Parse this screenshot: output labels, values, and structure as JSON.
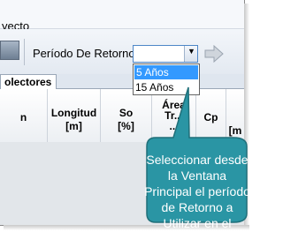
{
  "menu": {
    "item": "yecto"
  },
  "toolbar": {
    "label": "Período De Retorno:"
  },
  "dropdown": {
    "options": [
      "5 Años",
      "15 Años"
    ],
    "selected_index": 0
  },
  "tabs": {
    "active": "olectores"
  },
  "grid": {
    "columns": [
      "n",
      "Longitud\n[m]",
      "So\n[%]",
      "Área\nTr...\n...",
      "Cp",
      "\n[m"
    ]
  },
  "callout": {
    "text": "Seleccionar desde la Ventana Principal el período de Retorno a Utilizar en el cálculo"
  }
}
